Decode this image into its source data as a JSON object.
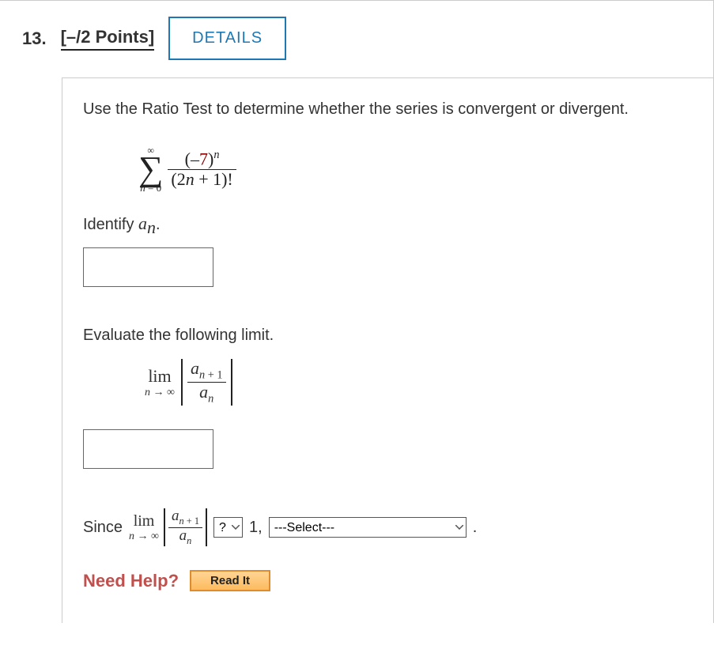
{
  "header": {
    "number": "13.",
    "points": "[–/2 Points]",
    "details_label": "DETAILS"
  },
  "instruction": "Use the Ratio Test to determine whether the series is convergent or divergent.",
  "series": {
    "sigma_top": "∞",
    "sigma_bottom_var": "n",
    "sigma_bottom_eq": " = 0",
    "num_open": "(–",
    "num_seven": "7",
    "num_close": ")",
    "num_exp": "n",
    "den_open": "(2",
    "den_n": "n",
    "den_close": " + 1)!"
  },
  "identify": {
    "label_pre": "Identify ",
    "a": "a",
    "sub": "n",
    "dot": "."
  },
  "evaluate_label": "Evaluate the following limit.",
  "limit": {
    "lim": "lim",
    "ninf_n": "n",
    "ninf_rest": " → ∞",
    "a": "a",
    "nplus1_n": "n",
    "nplus1_rest": " + 1",
    "n": "n"
  },
  "since": {
    "since": "Since",
    "compare_placeholder": "?",
    "one": "1,",
    "select_placeholder": "---Select---",
    "period": "."
  },
  "help": {
    "label": "Need Help?",
    "read": "Read It"
  }
}
